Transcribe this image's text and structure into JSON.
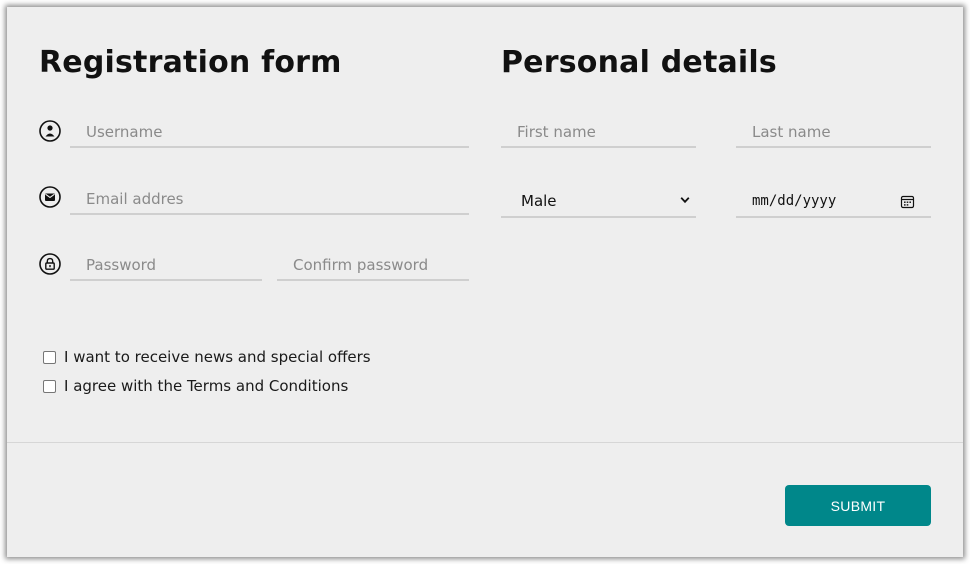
{
  "registration": {
    "title": "Registration form",
    "username_placeholder": "Username",
    "email_placeholder": "Email addres",
    "password_placeholder": "Password",
    "confirm_password_placeholder": "Confirm password"
  },
  "personal": {
    "title": "Personal details",
    "first_name_placeholder": "First name",
    "last_name_placeholder": "Last name",
    "gender_selected": "Male",
    "date_placeholder": "mm/dd/yyyy"
  },
  "checkboxes": {
    "news_label": "I want to receive news and special offers",
    "terms_label": "I agree with the Terms and Conditions"
  },
  "actions": {
    "submit_label": "SUBMIT"
  },
  "colors": {
    "background": "#eeeeee",
    "accent": "#00878a"
  },
  "icons": {
    "username": "user-icon",
    "email": "mail-icon",
    "password": "lock-icon",
    "gender": "chevron-down-icon",
    "date": "calendar-icon"
  }
}
